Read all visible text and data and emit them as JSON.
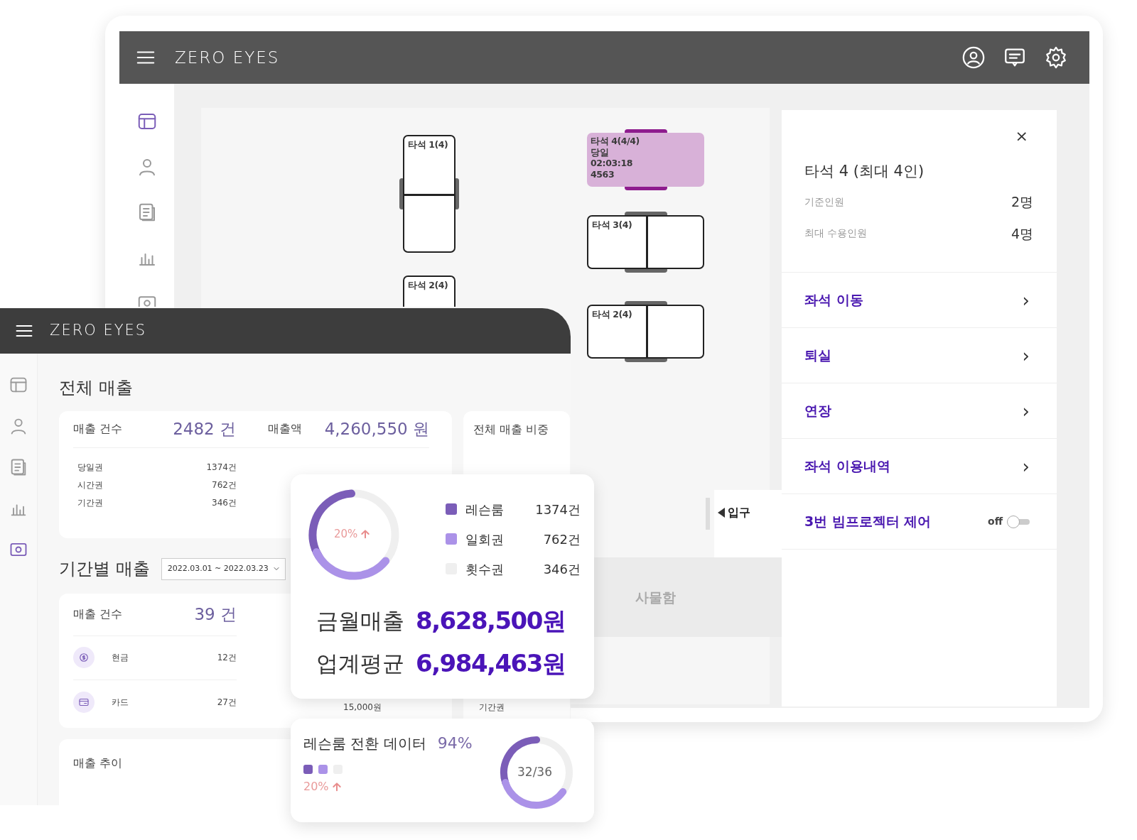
{
  "back_window": {
    "app_title": "ZERO EYES",
    "sidebar_items": [
      {
        "selected": true
      },
      {
        "selected": false
      },
      {
        "selected": false
      },
      {
        "selected": false
      },
      {
        "selected": false
      }
    ],
    "seats": [
      {
        "label": "타석 1(4)",
        "kind": "vertical",
        "occupied": false
      },
      {
        "label": "타석 2(4)",
        "kind": "vertical",
        "occupied": false
      },
      {
        "label": "타석 4(4/4)",
        "kind": "horizontal",
        "occupied": true,
        "details": [
          "당일",
          "02:03:18",
          "4563"
        ]
      },
      {
        "label": "타석 3(4)",
        "kind": "horizontal",
        "occupied": false
      },
      {
        "label": "타석 2(4)",
        "kind": "horizontal",
        "occupied": false
      }
    ],
    "entrance": "입구",
    "locker": "사물함",
    "detail_panel": {
      "close": "×",
      "title": "타석 4 (최대 4인)",
      "info": [
        {
          "label": "기준인원",
          "value": "2명"
        },
        {
          "label": "최대 수용인원",
          "value": "4명"
        }
      ],
      "actions": [
        {
          "label": "좌석 이동",
          "kind": "link",
          "chevron": "›"
        },
        {
          "label": "퇴실",
          "kind": "link",
          "chevron": "›"
        },
        {
          "label": "연장",
          "kind": "link",
          "chevron": "›"
        },
        {
          "label": "좌석 이용내역",
          "kind": "link",
          "chevron": "›"
        },
        {
          "label": "3번 빔프로젝터 제어",
          "kind": "toggle",
          "state_label": "off",
          "on": false
        }
      ]
    }
  },
  "front_window": {
    "app_title": "ZERO EYES",
    "sidebar_items": [
      {
        "selected": false
      },
      {
        "selected": false
      },
      {
        "selected": false
      },
      {
        "selected": false
      },
      {
        "selected": true
      }
    ],
    "total_sales": {
      "title": "전체 매출",
      "count_label": "매출 건수",
      "count_value": "2482 건",
      "amount_label": "매출액",
      "amount_value": "4,260,550 원",
      "rows": [
        {
          "name": "당일권",
          "count": "1374건"
        },
        {
          "name": "시간권",
          "count": "762건"
        },
        {
          "name": "기간권",
          "count": "346건"
        }
      ]
    },
    "share_title": "전체 매출 비중",
    "period_sales": {
      "title": "기간별 매출",
      "range": "2022.03.01 ~  2022.03.23",
      "count_label": "매출 건수",
      "count_value": "39 건",
      "rows": [
        {
          "name": "현금",
          "count": "12건",
          "kind": "cash"
        },
        {
          "name": "카드",
          "count": "27건",
          "kind": "card"
        }
      ],
      "amount_peek": "15,000원",
      "type_peek": "기간권"
    },
    "trend_title": "매출 추이"
  },
  "summary_card": {
    "change": "20%",
    "legend": [
      {
        "name": "레슨룸",
        "count": "1374건",
        "color": "#7b5db8"
      },
      {
        "name": "일회권",
        "count": "762건",
        "color": "#ab92e8"
      },
      {
        "name": "횟수권",
        "count": "346건",
        "color": "#efefef"
      }
    ],
    "totals": [
      {
        "label": "금월매출",
        "value": "8,628,500원"
      },
      {
        "label": "업계평균",
        "value": "6,984,463원"
      }
    ]
  },
  "conversion_card": {
    "title": "레슨룸 전환 데이터",
    "percent": "94%",
    "legend": [
      {
        "color": "#7b5db8"
      },
      {
        "color": "#ab92e8"
      },
      {
        "color": "#efefef"
      }
    ],
    "change": "20%",
    "ratio": "32/36"
  }
}
